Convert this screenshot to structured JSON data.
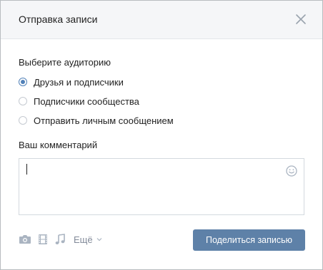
{
  "dialog": {
    "title": "Отправка записи"
  },
  "audience": {
    "label": "Выберите аудиторию",
    "options": [
      {
        "label": "Друзья и подписчики",
        "selected": true
      },
      {
        "label": "Подписчики сообщества",
        "selected": false
      },
      {
        "label": "Отправить личным сообщением",
        "selected": false
      }
    ]
  },
  "comment": {
    "label": "Ваш комментарий",
    "value": ""
  },
  "toolbar": {
    "icons": [
      "camera-icon",
      "video-icon",
      "music-icon"
    ],
    "more_label": "Ещё"
  },
  "actions": {
    "share_label": "Поделиться записью"
  },
  "colors": {
    "accent": "#5181b8",
    "button": "#5e81a8",
    "icon": "#aab4c1",
    "header_bg": "#f5f6f8"
  }
}
